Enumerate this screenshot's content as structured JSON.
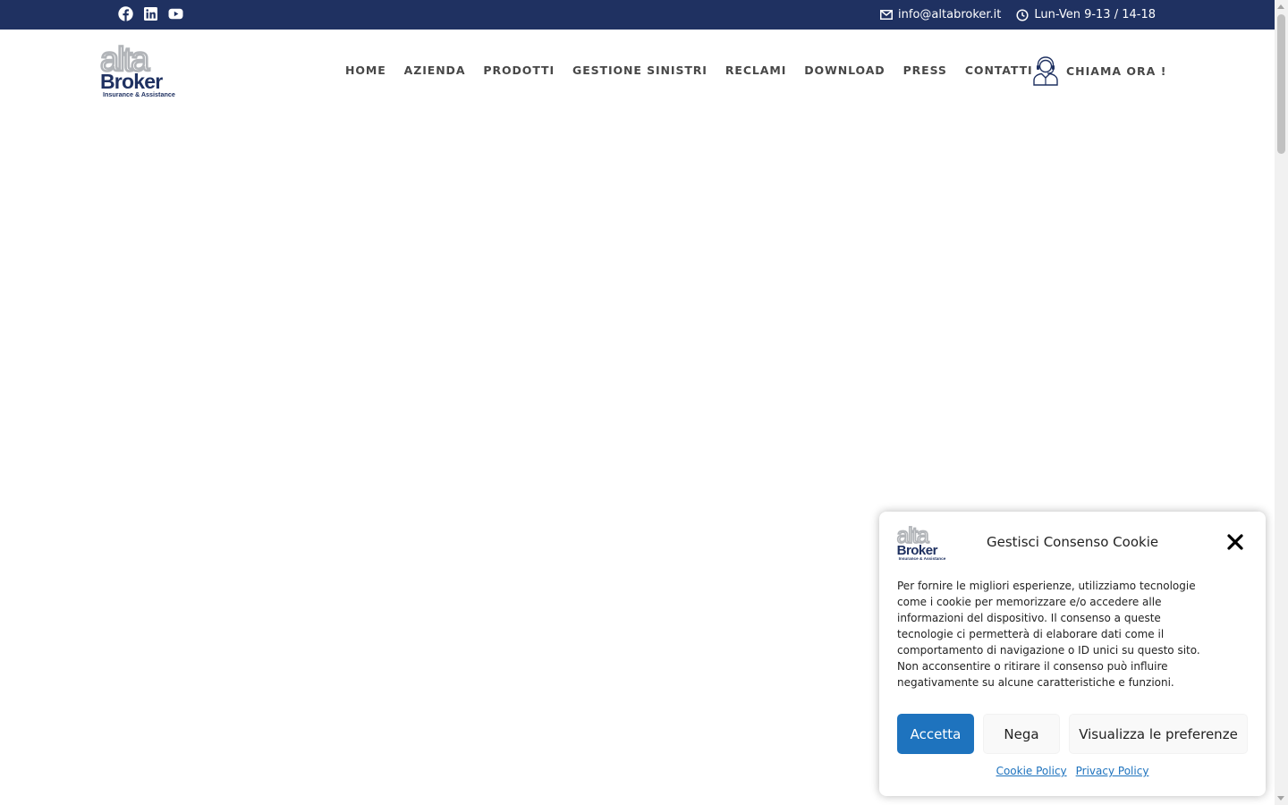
{
  "topbar": {
    "social_icons": [
      "facebook-icon",
      "linkedin-icon",
      "youtube-icon"
    ],
    "email": "info@altabroker.it",
    "hours": "Lun-Ven 9-13 / 14-18",
    "background_color": "#1f3161"
  },
  "header": {
    "logo": {
      "word_top": "alta",
      "word_main": "Broker",
      "tagline": "Insurance & Assistance"
    },
    "nav": [
      {
        "label": "HOME"
      },
      {
        "label": "AZIENDA"
      },
      {
        "label": "PRODOTTI"
      },
      {
        "label": "GESTIONE SINISTRI"
      },
      {
        "label": "RECLAMI"
      },
      {
        "label": "DOWNLOAD"
      },
      {
        "label": "PRESS"
      },
      {
        "label": "CONTATTI"
      }
    ],
    "call_label": "CHIAMA ORA !",
    "call_icon": "call-center-agent-icon"
  },
  "cookie_banner": {
    "title": "Gestisci Consenso Cookie",
    "text": "Per fornire le migliori esperienze, utilizziamo tecnologie come i cookie per memorizzare e/o accedere alle informazioni del dispositivo. Il consenso a queste tecnologie ci permetterà di elaborare dati come il comportamento di navigazione o ID unici su questo sito. Non acconsentire o ritirare il consenso può influire negativamente su alcune caratteristiche e funzioni.",
    "buttons": {
      "accept": "Accetta",
      "deny": "Nega",
      "preferences": "Visualizza le preferenze"
    },
    "links": {
      "cookie_policy": "Cookie Policy",
      "privacy_policy": "Privacy Policy"
    },
    "accent_color": "#1e73be"
  }
}
